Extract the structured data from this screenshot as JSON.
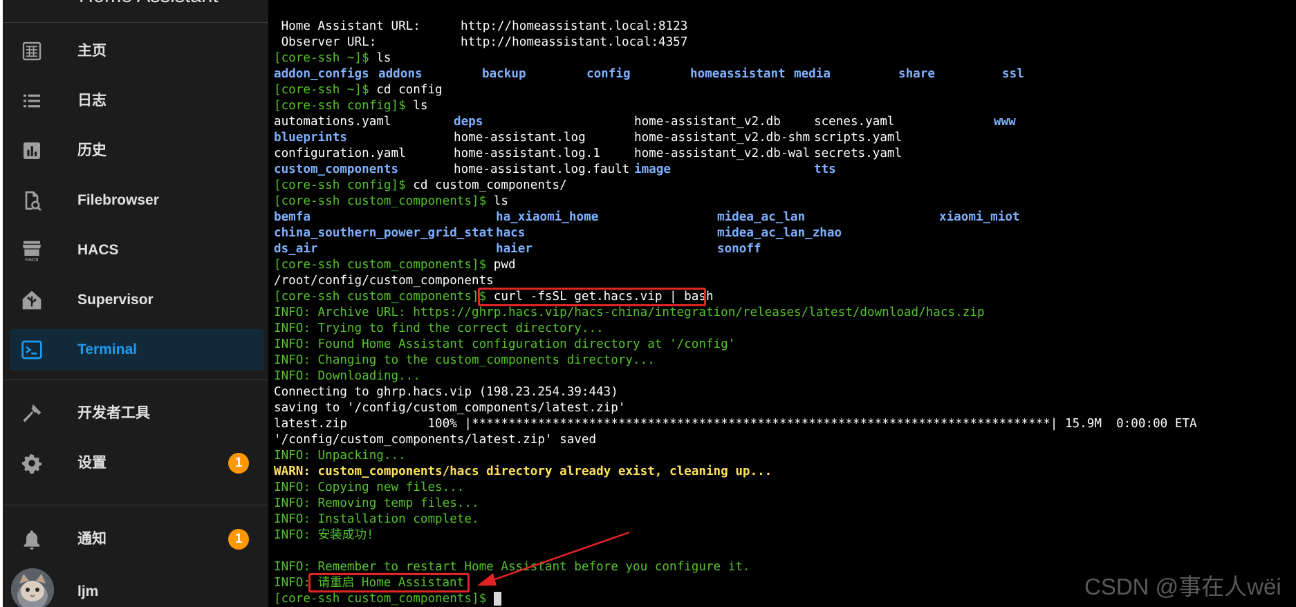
{
  "sidebar": {
    "title": "Home Assistant",
    "items": [
      {
        "label": "主页",
        "icon": "dashboard-icon"
      },
      {
        "label": "日志",
        "icon": "logbook-icon"
      },
      {
        "label": "历史",
        "icon": "history-icon"
      },
      {
        "label": "Filebrowser",
        "icon": "file-search-icon"
      },
      {
        "label": "HACS",
        "icon": "hacs-icon"
      },
      {
        "label": "Supervisor",
        "icon": "supervisor-icon"
      },
      {
        "label": "Terminal",
        "icon": "terminal-icon"
      },
      {
        "label": "开发者工具",
        "icon": "hammer-icon"
      },
      {
        "label": "设置",
        "icon": "gear-icon",
        "badge": "1"
      }
    ],
    "active_item": "Terminal",
    "notifications": {
      "label": "通知",
      "icon": "bell-icon",
      "badge": "1"
    },
    "user": {
      "name": "ljm"
    },
    "colors": {
      "background": "#1c1c1c",
      "active_bg": "#12293a",
      "active_text": "#1e9bf0",
      "badge": "#ff9800"
    }
  },
  "terminal": {
    "prompt_home": "[core-ssh ~]$ ",
    "prompt_config": "[core-ssh config]$ ",
    "prompt_cc": "[core-ssh custom_components]$ ",
    "ha_url_label": " Home Assistant URL:",
    "ha_url": "http://homeassistant.local:8123",
    "observer_url_label": " Observer URL:",
    "observer_url": "http://homeassistant.local:4357",
    "cmd_ls": "ls",
    "cmd_cd_config": "cd config",
    "cmd_cd_cc": "cd custom_components/",
    "cmd_pwd": "pwd",
    "cmd_curl": "curl -fsSL get.hacs.vip | bash",
    "root_listing": [
      "addon_configs",
      "addons",
      "backup",
      "config",
      "homeassistant",
      "media",
      "share",
      "ssl"
    ],
    "config_listing": {
      "col1": [
        "automations.yaml",
        "blueprints",
        "configuration.yaml",
        "custom_components"
      ],
      "col2": [
        "deps",
        "home-assistant.log",
        "home-assistant.log.1",
        "home-assistant.log.fault"
      ],
      "col3": [
        "home-assistant_v2.db",
        "home-assistant_v2.db-shm",
        "home-assistant_v2.db-wal",
        "image"
      ],
      "col4": [
        "scenes.yaml",
        "scripts.yaml",
        "secrets.yaml",
        "tts"
      ],
      "col5": [
        "www"
      ]
    },
    "cc_listing": {
      "col1": [
        "bemfa",
        "china_southern_power_grid_stat",
        "ds_air"
      ],
      "col2": [
        "ha_xiaomi_home",
        "hacs",
        "haier"
      ],
      "col3": [
        "midea_ac_lan",
        "midea_ac_lan_zhao",
        "sonoff"
      ],
      "col4": [
        "xiaomi_miot"
      ]
    },
    "pwd_output": "/root/config/custom_components",
    "info_archive": "INFO: Archive URL: https://ghrp.hacs.vip/hacs-china/integration/releases/latest/download/hacs.zip",
    "info_trying": "INFO: Trying to find the correct directory...",
    "info_found": "INFO: Found Home Assistant configuration directory at '/config'",
    "info_changing": "INFO: Changing to the custom_components directory...",
    "info_downloading": "INFO: Downloading...",
    "connecting": "Connecting to ghrp.hacs.vip (198.23.254.39:443)",
    "saving": "saving to '/config/custom_components/latest.zip'",
    "progress_line": "latest.zip           100% |*******************************************************************************| 15.9M  0:00:00 ETA",
    "saved": "'/config/custom_components/latest.zip' saved",
    "info_unpacking": "INFO: Unpacking...",
    "warn_exist": "WARN: custom_components/hacs directory already exist, cleaning up...",
    "info_copying": "INFO: Copying new files...",
    "info_removing": "INFO: Removing temp files...",
    "info_complete": "INFO: Installation complete.",
    "info_success": "INFO: 安装成功!",
    "info_remember": "INFO: Remember to restart Home Assistant before you configure it.",
    "info_prefix": "INFO: ",
    "info_restart": "请重启 Home Assistant",
    "colors": {
      "background": "#000000",
      "prompt": "#54c32b",
      "directory": "#7fb1ff",
      "warn": "#ffe35b",
      "highlight_box": "#e32424"
    }
  },
  "watermark": "CSDN @事在人wëi"
}
